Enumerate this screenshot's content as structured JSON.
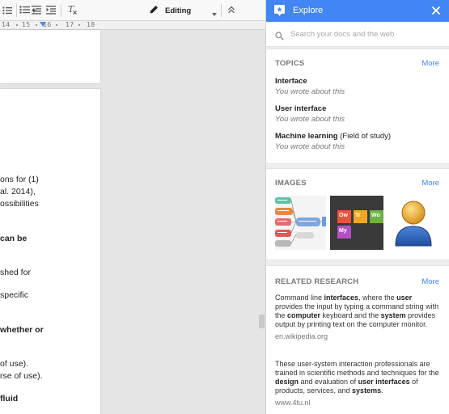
{
  "toolbar": {
    "mode_label": "Editing",
    "ruler_numbers": [
      "14",
      "15",
      "16",
      "17",
      "18"
    ]
  },
  "document": {
    "lines": [
      {
        "text": "ons for (1)",
        "bold": false
      },
      {
        "text": "al. 2014),",
        "bold": false
      },
      {
        "text": "ossibilities",
        "bold": false
      },
      {
        "text": "can be",
        "bold": true
      },
      {
        "text": "shed for",
        "bold": false
      },
      {
        "text": "specific",
        "bold": false
      },
      {
        "text": "whether or",
        "bold": true
      },
      {
        "text": "of use).",
        "bold": false
      },
      {
        "text": "rse of use).",
        "bold": false
      },
      {
        "text": "fluid",
        "bold": true
      }
    ]
  },
  "explore": {
    "title": "Explore",
    "search_placeholder": "Search your docs and the web",
    "topics": {
      "heading": "TOPICS",
      "more": "More",
      "items": [
        {
          "name": "Interface",
          "type": "",
          "subtitle": "You wrote about this"
        },
        {
          "name": "User interface",
          "type": "",
          "subtitle": "You wrote about this"
        },
        {
          "name": "Machine learning",
          "type": "(Field of study)",
          "subtitle": "You wrote about this"
        }
      ]
    },
    "images": {
      "heading": "IMAGES",
      "more": "More",
      "tiles": [
        {
          "label": "Ow",
          "color": "#e8553c"
        },
        {
          "label": "Tr",
          "color": "#f4a623"
        },
        {
          "label": "Wo",
          "color": "#6cb33f"
        },
        {
          "label": "My",
          "color": "#b14fc5"
        }
      ]
    },
    "research": {
      "heading": "RELATED RESEARCH",
      "more": "More",
      "items": [
        {
          "segments": [
            {
              "t": "Command line ",
              "b": false
            },
            {
              "t": "interfaces",
              "b": true
            },
            {
              "t": ", where the ",
              "b": false
            },
            {
              "t": "user",
              "b": true
            },
            {
              "t": " provides the input by typing a command string with the ",
              "b": false
            },
            {
              "t": "computer",
              "b": true
            },
            {
              "t": " keyboard and the ",
              "b": false
            },
            {
              "t": "system",
              "b": true
            },
            {
              "t": " provides output by printing text on the computer monitor.",
              "b": false
            }
          ],
          "source": "en.wikipedia.org"
        },
        {
          "segments": [
            {
              "t": "These user-system interaction professionals are trained in scientific methods and techniques for the ",
              "b": false
            },
            {
              "t": "design",
              "b": true
            },
            {
              "t": " and evaluation of ",
              "b": false
            },
            {
              "t": "user interfaces",
              "b": true
            },
            {
              "t": " of products, services, and ",
              "b": false
            },
            {
              "t": "systems",
              "b": true
            },
            {
              "t": ".",
              "b": false
            }
          ],
          "source": "www.4tu.nl"
        }
      ]
    }
  },
  "colors": {
    "accent": "#4285f4",
    "header_text": "#ffffff"
  }
}
